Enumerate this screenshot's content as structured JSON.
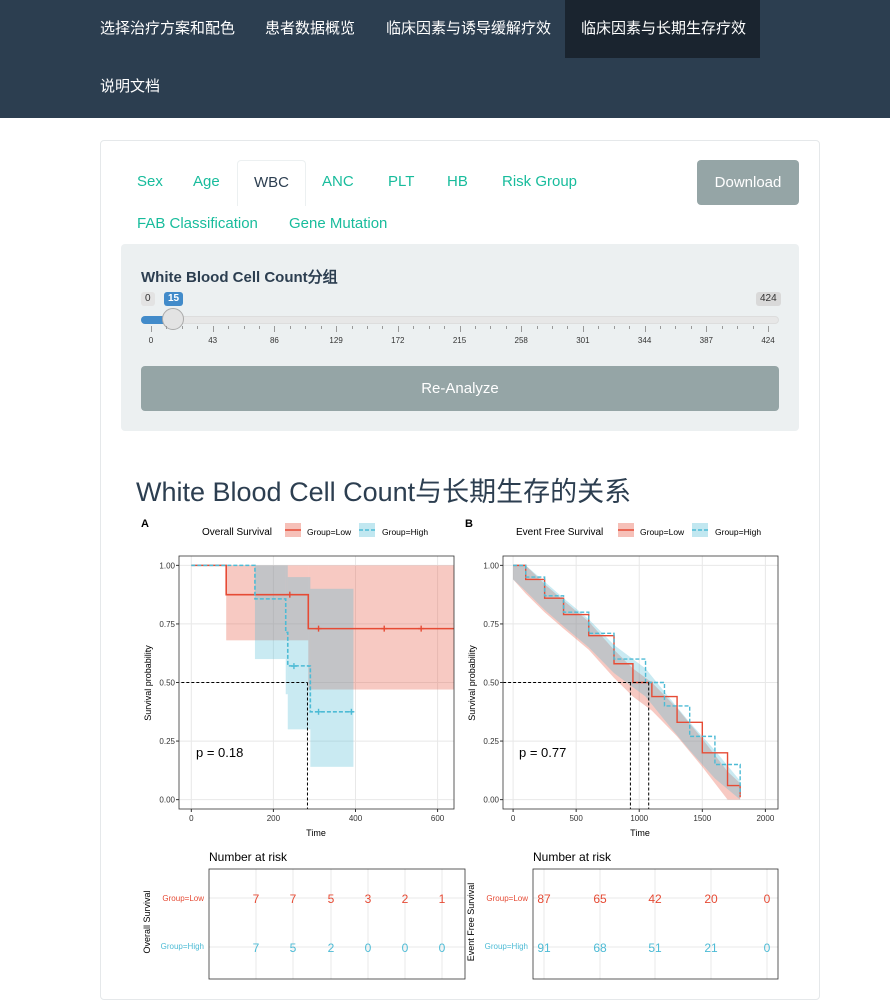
{
  "nav": {
    "items": [
      "选择治疗方案和配色",
      "患者数据概览",
      "临床因素与诱导缓解疗效",
      "临床因素与长期生存疗效",
      "说明文档"
    ],
    "active_index": 3
  },
  "tabs": {
    "items": [
      "Sex",
      "Age",
      "WBC",
      "ANC",
      "PLT",
      "HB",
      "Risk Group",
      "FAB Classification",
      "Gene Mutation"
    ],
    "active": "WBC"
  },
  "download_label": "Download",
  "slider": {
    "title": "White Blood Cell Count分组",
    "min_label": "0",
    "value_label": "15",
    "max_label": "424",
    "min": 0,
    "max": 424,
    "value": 15,
    "ticks": [
      "0",
      "43",
      "86",
      "129",
      "172",
      "215",
      "258",
      "301",
      "344",
      "387",
      "424"
    ]
  },
  "reanalyze_label": "Re-Analyze",
  "section_title": "White Blood Cell Count与长期生存的关系",
  "colors": {
    "low": "#e64b35",
    "high": "#4dbbd5",
    "accent": "#18bc9c",
    "nav": "#2c3e50"
  },
  "chart_data": [
    {
      "type": "line",
      "panel": "A",
      "title": "Overall Survival",
      "legend": [
        "Group=Low",
        "Group=High"
      ],
      "xlabel": "Time",
      "ylabel": "Survival probability",
      "xlim": [
        -30,
        640
      ],
      "ylim": [
        0,
        1
      ],
      "xticks": [
        "0",
        "200",
        "400",
        "600"
      ],
      "yticks": [
        "0.00",
        "0.25",
        "0.50",
        "0.75",
        "1.00"
      ],
      "pvalue": "p = 0.18",
      "series": [
        {
          "name": "Group=Low",
          "steps": [
            [
              0,
              1
            ],
            [
              85,
              0.875
            ],
            [
              285,
              0.73
            ],
            [
              640,
              0.73
            ]
          ],
          "band": [
            [
              0,
              1,
              1
            ],
            [
              85,
              0.68,
              1
            ],
            [
              285,
              0.47,
              1
            ],
            [
              640,
              0.47,
              1
            ]
          ],
          "censored": [
            [
              240,
              0.875
            ],
            [
              310,
              0.73
            ],
            [
              470,
              0.73
            ],
            [
              560,
              0.73
            ]
          ]
        },
        {
          "name": "Group=High",
          "steps": [
            [
              0,
              1
            ],
            [
              155,
              0.857
            ],
            [
              230,
              0.714
            ],
            [
              235,
              0.571
            ],
            [
              285,
              0.57
            ],
            [
              290,
              0.375
            ],
            [
              395,
              0.375
            ]
          ],
          "band": [
            [
              0,
              1,
              1
            ],
            [
              155,
              0.6,
              1
            ],
            [
              230,
              0.45,
              1
            ],
            [
              235,
              0.3,
              0.95
            ],
            [
              290,
              0.14,
              0.9
            ],
            [
              395,
              0.14,
              0.9
            ]
          ],
          "censored": [
            [
              250,
              0.57
            ],
            [
              310,
              0.375
            ],
            [
              390,
              0.375
            ]
          ]
        }
      ],
      "median_lines": [
        283
      ]
    },
    {
      "type": "line",
      "panel": "B",
      "title": "Event Free Survival",
      "legend": [
        "Group=Low",
        "Group=High"
      ],
      "xlabel": "Time",
      "ylabel": "Survival probability",
      "xlim": [
        -80,
        2100
      ],
      "ylim": [
        0,
        1
      ],
      "xticks": [
        "0",
        "500",
        "1000",
        "1500",
        "2000"
      ],
      "yticks": [
        "0.00",
        "0.25",
        "0.50",
        "0.75",
        "1.00"
      ],
      "pvalue": "p = 0.77",
      "series": [
        {
          "name": "Group=Low",
          "points": [
            [
              0,
              1
            ],
            [
              100,
              0.94
            ],
            [
              250,
              0.86
            ],
            [
              400,
              0.79
            ],
            [
              600,
              0.7
            ],
            [
              800,
              0.58
            ],
            [
              950,
              0.5
            ],
            [
              1100,
              0.44
            ],
            [
              1300,
              0.33
            ],
            [
              1500,
              0.2
            ],
            [
              1700,
              0.06
            ],
            [
              1800,
              0.01
            ]
          ]
        },
        {
          "name": "Group=High",
          "points": [
            [
              0,
              1
            ],
            [
              100,
              0.95
            ],
            [
              250,
              0.87
            ],
            [
              400,
              0.8
            ],
            [
              600,
              0.71
            ],
            [
              800,
              0.6
            ],
            [
              1050,
              0.5
            ],
            [
              1200,
              0.4
            ],
            [
              1400,
              0.27
            ],
            [
              1600,
              0.15
            ],
            [
              1800,
              0.02
            ]
          ]
        }
      ],
      "median_lines": [
        930,
        1075
      ]
    }
  ],
  "risk_tables": [
    {
      "title": "Number at risk",
      "ylabel": "Overall Survival",
      "rows": [
        {
          "name": "Group=Low",
          "values": [
            "7",
            "7",
            "5",
            "3",
            "2",
            "1"
          ]
        },
        {
          "name": "Group=High",
          "values": [
            "7",
            "5",
            "2",
            "0",
            "0",
            "0"
          ]
        }
      ]
    },
    {
      "title": "Number at risk",
      "ylabel": "Event Free Survival",
      "rows": [
        {
          "name": "Group=Low",
          "values": [
            "87",
            "65",
            "42",
            "20",
            "0"
          ]
        },
        {
          "name": "Group=High",
          "values": [
            "91",
            "68",
            "51",
            "21",
            "0"
          ]
        }
      ]
    }
  ]
}
